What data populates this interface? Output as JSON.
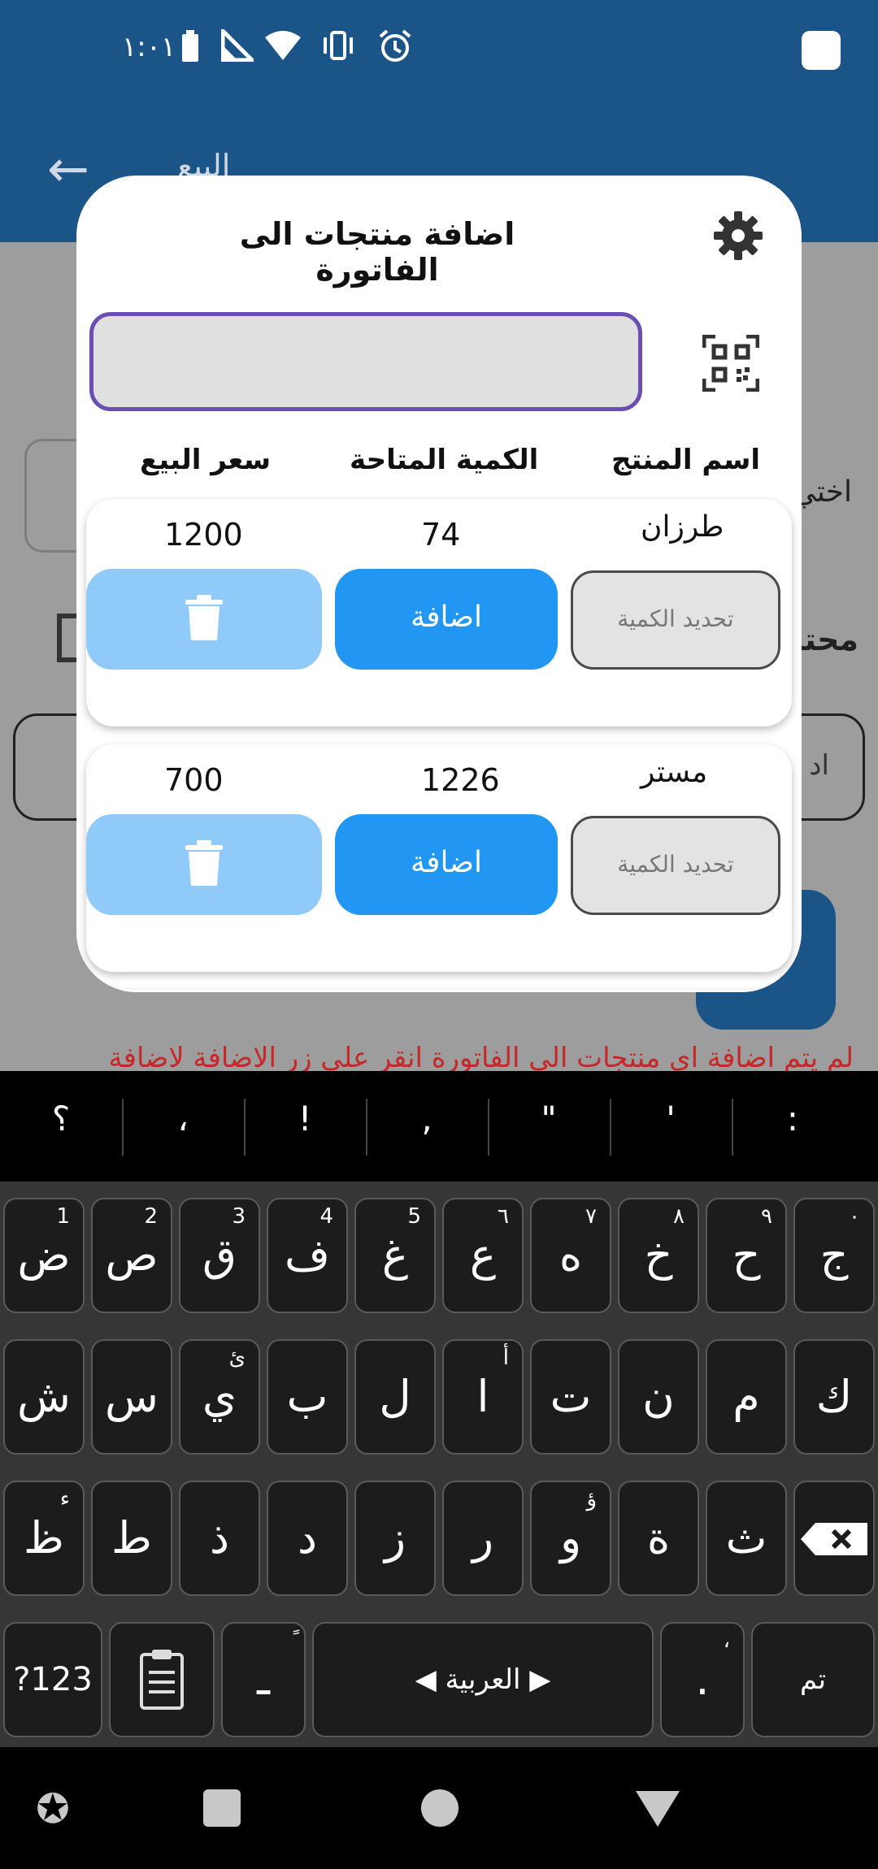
{
  "status_bar": {
    "time": "١:٠١",
    "icons": [
      "battery-icon",
      "signal-icon",
      "wifi-icon",
      "vibrate-icon",
      "alarm-icon"
    ]
  },
  "app_bar": {
    "title": "البيع"
  },
  "background": {
    "label_choose": "اختي",
    "label_content": "محتو",
    "input_text": "اد",
    "error_text": "لم يتم اضافة اي منتجات الى الفاتورة انقر على زر الاضافة لاضافة"
  },
  "dialog": {
    "title": "اضافة منتجات الى الفاتورة",
    "search_value": "",
    "columns": {
      "price": "سعر البيع",
      "qty": "الكمية المتاحة",
      "name": "اسم المنتج"
    },
    "products": [
      {
        "name": "طرزان",
        "qty": "74",
        "price": "1200",
        "add_label": "اضافة",
        "qty_placeholder": "تحديد الكمية"
      },
      {
        "name": "مستر",
        "qty": "1226",
        "price": "700",
        "add_label": "اضافة",
        "qty_placeholder": "تحديد الكمية"
      }
    ]
  },
  "keyboard": {
    "suggestions": [
      "؟",
      "،",
      "!",
      ",",
      "\"",
      "'",
      ":"
    ],
    "row1": [
      {
        "key": "ض",
        "hint": "1"
      },
      {
        "key": "ص",
        "hint": "2"
      },
      {
        "key": "ق",
        "hint": "3"
      },
      {
        "key": "ف",
        "hint": "4"
      },
      {
        "key": "غ",
        "hint": "5"
      },
      {
        "key": "ع",
        "hint": "٦"
      },
      {
        "key": "ه",
        "hint": "٧"
      },
      {
        "key": "خ",
        "hint": "٨"
      },
      {
        "key": "ح",
        "hint": "٩"
      },
      {
        "key": "ج",
        "hint": "٠"
      }
    ],
    "row2": [
      {
        "key": "ش",
        "hint": ""
      },
      {
        "key": "س",
        "hint": ""
      },
      {
        "key": "ي",
        "hint": "ئ"
      },
      {
        "key": "ب",
        "hint": ""
      },
      {
        "key": "ل",
        "hint": ""
      },
      {
        "key": "ا",
        "hint": "أ"
      },
      {
        "key": "ت",
        "hint": ""
      },
      {
        "key": "ن",
        "hint": ""
      },
      {
        "key": "م",
        "hint": ""
      },
      {
        "key": "ك",
        "hint": ""
      }
    ],
    "row3": [
      {
        "key": "ظ",
        "hint": "ء"
      },
      {
        "key": "ط",
        "hint": ""
      },
      {
        "key": "ذ",
        "hint": ""
      },
      {
        "key": "د",
        "hint": ""
      },
      {
        "key": "ز",
        "hint": ""
      },
      {
        "key": "ر",
        "hint": ""
      },
      {
        "key": "و",
        "hint": "ؤ"
      },
      {
        "key": "ة",
        "hint": ""
      },
      {
        "key": "ث",
        "hint": ""
      }
    ],
    "bottom": {
      "symbols": "?123",
      "dash": "ـ",
      "dash_hint": "ً",
      "space": "◀ العربية ▶",
      "period": ".",
      "period_hint": "،",
      "done": "تم"
    },
    "backspace_icon": "backspace-icon",
    "clipboard_icon": "clipboard-icon"
  },
  "nav_bar": {
    "icons": [
      "accessibility-icon",
      "recents-icon",
      "home-icon",
      "back-icon"
    ]
  }
}
